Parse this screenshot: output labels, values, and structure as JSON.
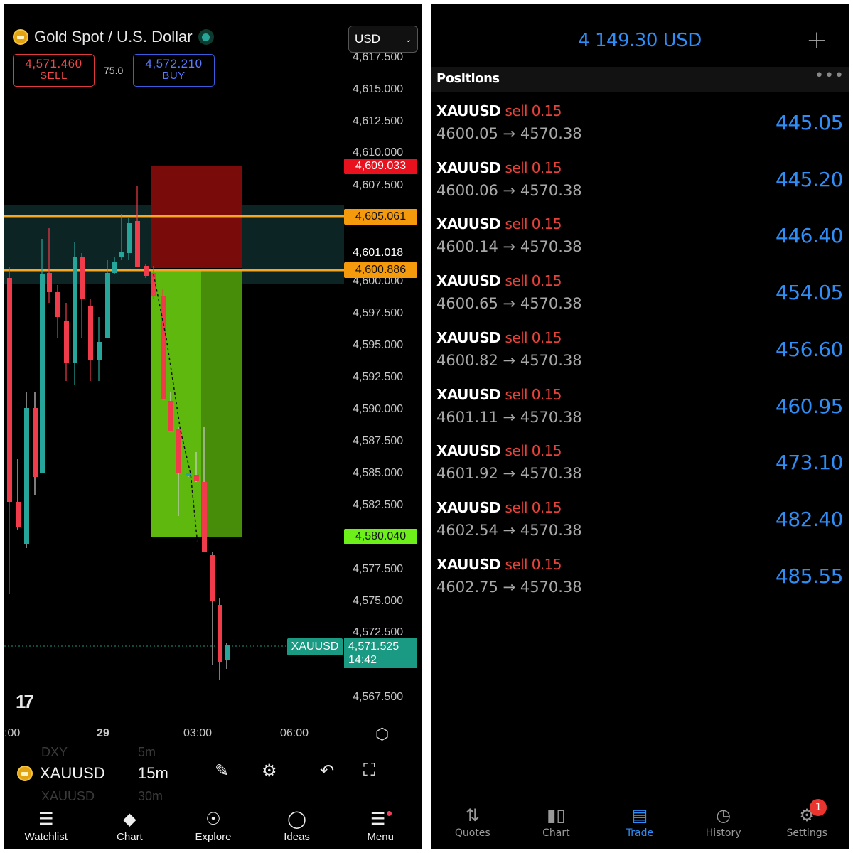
{
  "left_app": {
    "symbol_title": "Gold Spot / U.S. Dollar",
    "currency": "USD",
    "sell": {
      "price": "4,571.460",
      "label": "SELL"
    },
    "buy": {
      "price": "4,572.210",
      "label": "BUY"
    },
    "spread": "75.0",
    "y_ticks": [
      "4,617.500",
      "4,615.000",
      "4,612.500",
      "4,610.000",
      "4,607.500",
      "4,600.000",
      "4,597.500",
      "4,595.000",
      "4,592.500",
      "4,590.000",
      "4,587.500",
      "4,585.000",
      "4,582.500",
      "4,577.500",
      "4,575.000",
      "4,572.500",
      "4,567.500"
    ],
    "price_badges": {
      "stop_loss": "4,609.033",
      "resistance": "4,605.061",
      "entry": "4,601.018",
      "support": "4,600.886",
      "take_profit": "4,580.040"
    },
    "current": {
      "symbol": "XAUUSD",
      "price": "4,571.525",
      "countdown": "14:42"
    },
    "x_ticks": [
      ":00",
      "29",
      "03:00",
      "06:00"
    ],
    "toolbar": {
      "ghost_top": "DXY",
      "ghost_top_interval": "5m",
      "symbol": "XAUUSD",
      "interval": "15m",
      "ghost_bottom": "XAUUSD",
      "ghost_bottom_interval": "30m"
    },
    "tabs": [
      "Watchlist",
      "Chart",
      "Explore",
      "Ideas",
      "Menu"
    ],
    "colors": {
      "up": "#26a69a",
      "down": "#ef3b4a",
      "level": "#f5a623",
      "sl_zone": "#7a0b0b",
      "tp_zone": "#5fb80d"
    }
  },
  "right_app": {
    "balance": "4 149.30 USD",
    "positions_title": "Positions",
    "positions": [
      {
        "symbol": "XAUUSD",
        "side": "sell 0.15",
        "open": "4600.05",
        "current": "4570.38",
        "profit": "445.05"
      },
      {
        "symbol": "XAUUSD",
        "side": "sell 0.15",
        "open": "4600.06",
        "current": "4570.38",
        "profit": "445.20"
      },
      {
        "symbol": "XAUUSD",
        "side": "sell 0.15",
        "open": "4600.14",
        "current": "4570.38",
        "profit": "446.40"
      },
      {
        "symbol": "XAUUSD",
        "side": "sell 0.15",
        "open": "4600.65",
        "current": "4570.38",
        "profit": "454.05"
      },
      {
        "symbol": "XAUUSD",
        "side": "sell 0.15",
        "open": "4600.82",
        "current": "4570.38",
        "profit": "456.60"
      },
      {
        "symbol": "XAUUSD",
        "side": "sell 0.15",
        "open": "4601.11",
        "current": "4570.38",
        "profit": "460.95"
      },
      {
        "symbol": "XAUUSD",
        "side": "sell 0.15",
        "open": "4601.92",
        "current": "4570.38",
        "profit": "473.10"
      },
      {
        "symbol": "XAUUSD",
        "side": "sell 0.15",
        "open": "4602.54",
        "current": "4570.38",
        "profit": "482.40"
      },
      {
        "symbol": "XAUUSD",
        "side": "sell 0.15",
        "open": "4602.75",
        "current": "4570.38",
        "profit": "485.55"
      }
    ],
    "tabs": [
      "Quotes",
      "Chart",
      "Trade",
      "History",
      "Settings"
    ],
    "active_tab": "Trade",
    "settings_badge": "1"
  }
}
